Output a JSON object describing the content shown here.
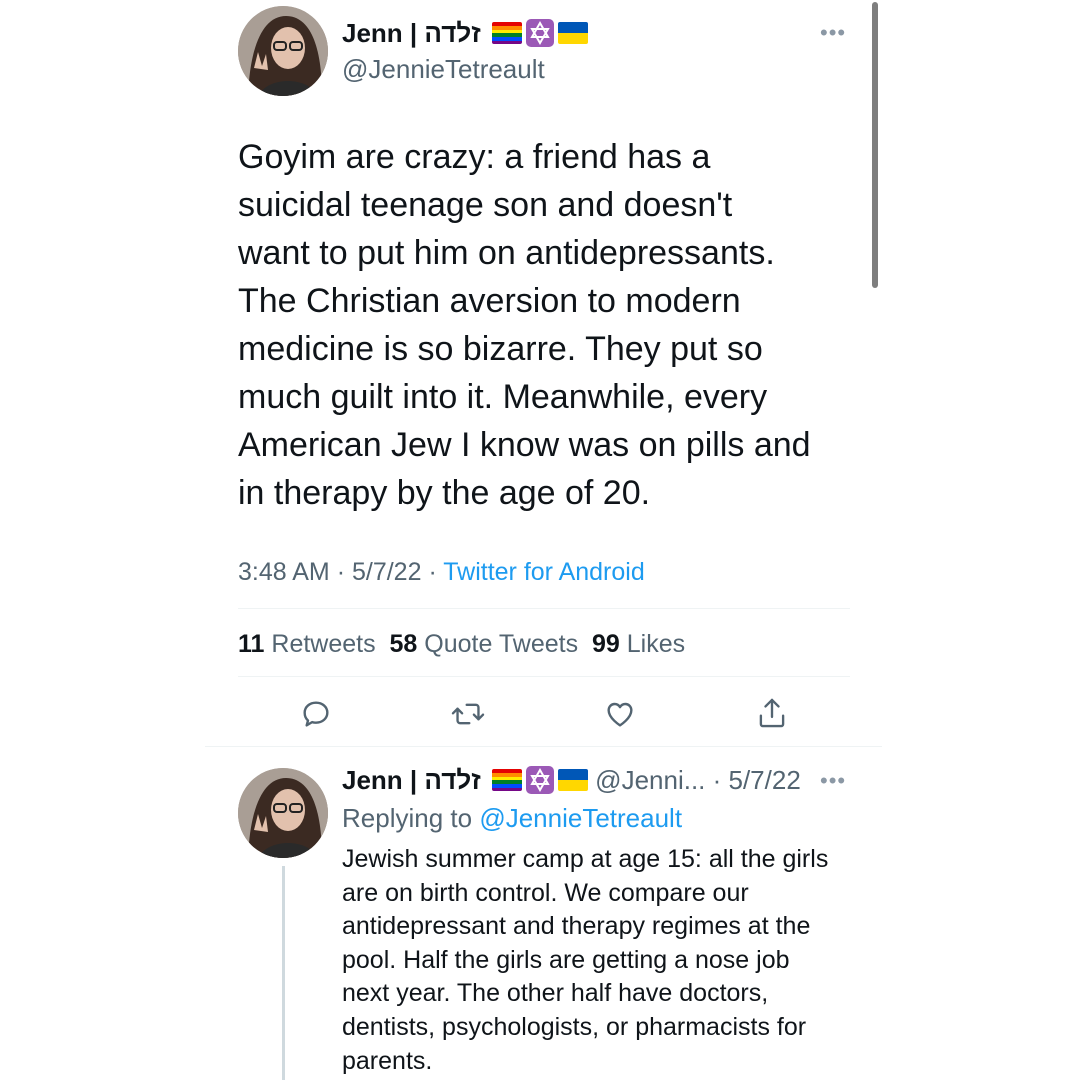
{
  "main_tweet": {
    "display_name": "Jenn | זלדה",
    "handle": "@JennieTetreault",
    "more_icon": "more-horizontal-icon",
    "badges": [
      "rainbow-flag-icon",
      "star-of-david-icon",
      "ukraine-flag-icon"
    ],
    "text": "Goyim are crazy: a friend has a\nsuicidal teenage son and doesn't\nwant to put him on antidepressants.\nThe Christian aversion to modern\nmedicine is so bizarre. They put so\nmuch guilt into it. Meanwhile, every\nAmerican Jew I know was on pills and\nin therapy by the age of 20.",
    "time": "3:48 AM",
    "date": "5/7/22",
    "separator": "·",
    "source": "Twitter for Android",
    "retweets_count": "11",
    "retweets_label": "Retweets",
    "quotes_count": "58",
    "quotes_label": "Quote Tweets",
    "likes_count": "99",
    "likes_label": "Likes",
    "actions": [
      "reply-icon",
      "retweet-icon",
      "like-icon",
      "share-icon"
    ]
  },
  "reply_tweet": {
    "display_name": "Jenn | זלדה",
    "handle_date": "@Jenni... · 5/7/22",
    "replying_prefix": "Replying to",
    "replying_to": "@JennieTetreault",
    "text": "Jewish summer camp at age 15: all the girls\nare on birth control. We compare our\nantidepressant and therapy regimes at the\npool. Half the girls are getting a nose job\nnext year. The other half have doctors,\ndentists, psychologists, or pharmacists for\nparents."
  },
  "colors": {
    "accent": "#1d9bf0",
    "secondary_text": "#536471",
    "primary_text": "#0f1419",
    "divider": "#eff3f4"
  }
}
